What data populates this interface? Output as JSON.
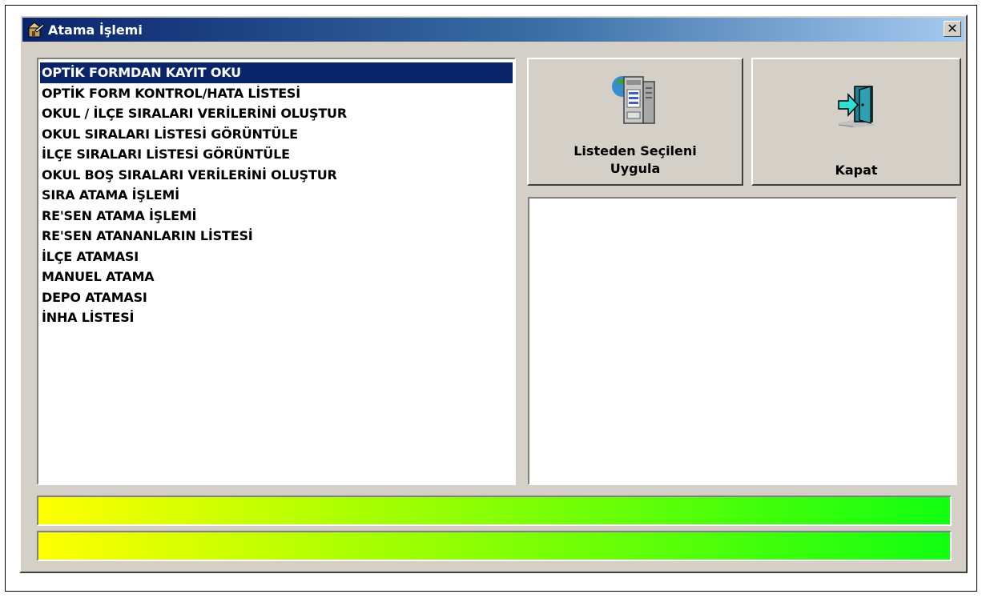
{
  "window": {
    "title": "Atama İşlemi",
    "close_glyph": "✕"
  },
  "list": {
    "selected_index": 0,
    "items": [
      "OPTİK FORMDAN KAYIT OKU",
      "OPTİK FORM KONTROL/HATA LİSTESİ",
      "OKUL / İLÇE SIRALARI VERİLERİNİ OLUŞTUR",
      "OKUL SIRALARI LİSTESİ GÖRÜNTÜLE",
      "İLÇE SIRALARI LİSTESİ GÖRÜNTÜLE",
      "OKUL BOŞ SIRALARI VERİLERİNİ OLUŞTUR",
      "SIRA ATAMA İŞLEMİ",
      "RE'SEN ATAMA İŞLEMİ",
      "RE'SEN ATANANLARIN LİSTESİ",
      "İLÇE ATAMASI",
      "MANUEL ATAMA",
      "DEPO ATAMASI",
      "İNHA LİSTESİ"
    ]
  },
  "buttons": {
    "apply_line1": "Listeden Seçileni",
    "apply_line2": "Uygula",
    "close_label": "Kapat",
    "apply_icon": "server-computer-icon",
    "close_icon": "exit-door-icon"
  },
  "progress": {
    "bar1_fraction": 1.0,
    "bar2_fraction": 1.0
  },
  "colors": {
    "selection": "#0a246a",
    "face": "#d4d0c8",
    "progress_start": "#ffff00",
    "progress_end": "#11ff11"
  }
}
